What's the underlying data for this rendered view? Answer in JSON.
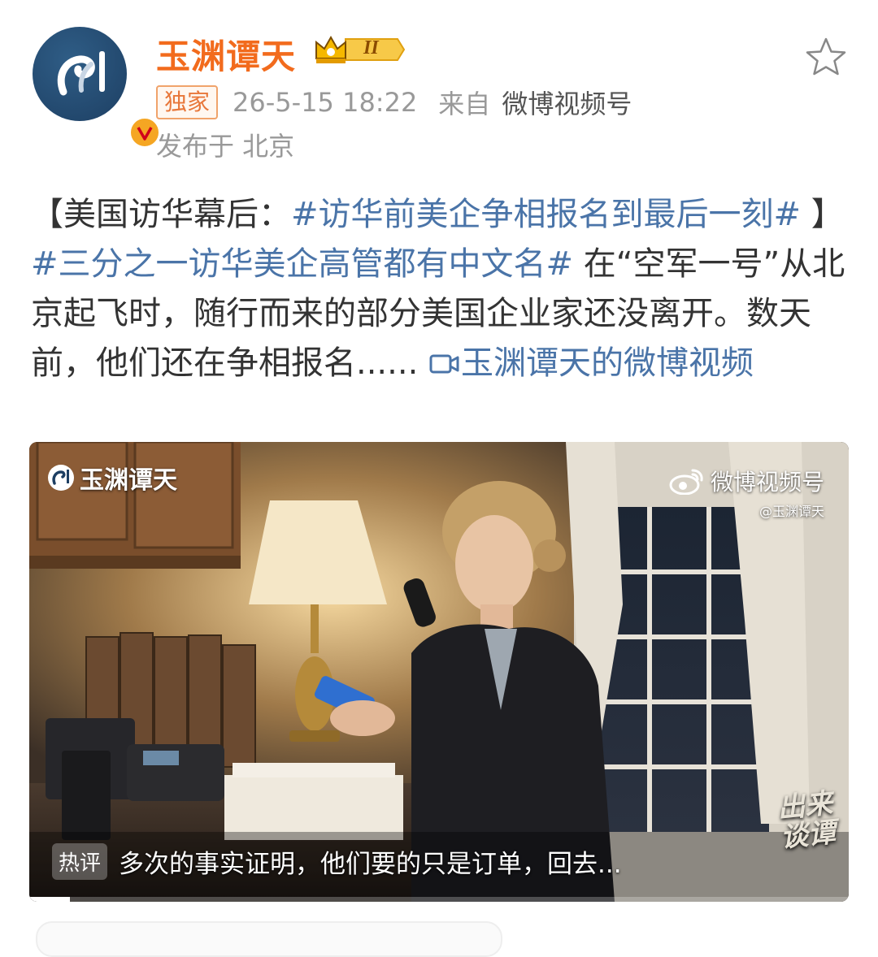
{
  "post": {
    "author": "玉渊谭天",
    "level_badge": "II",
    "exclusive_tag": "独家",
    "timestamp": "26-5-15 18:22",
    "source_prefix": "来自",
    "source_name": "微博视频号",
    "location": "发布于 北京"
  },
  "content": {
    "p1": "【美国访华幕后：",
    "topic1": "#访华前美企争相报名到最后一刻#",
    "p2": " 】",
    "topic2": "#三分之一访华美企高管都有中文名#",
    "p3": " 在“空军一号”从北京起飞时，随行而来的部分美国企业家还没离开。数天前，他们还在争相报名......",
    "video_link": "玉渊谭天的微博视频"
  },
  "video": {
    "watermark_left": "玉渊谭天",
    "watermark_right": "微博视频号",
    "watermark_handle": "@玉渊谭天",
    "show_logo_line1": "出来",
    "show_logo_line2": "谈谭",
    "hot_badge": "热评",
    "hot_comment": "多次的事实证明，他们要的只是订单，回去...",
    "progress": 0.05
  },
  "colors": {
    "author": "#f26b1d",
    "link": "#4a74a8",
    "meta": "#999999"
  }
}
